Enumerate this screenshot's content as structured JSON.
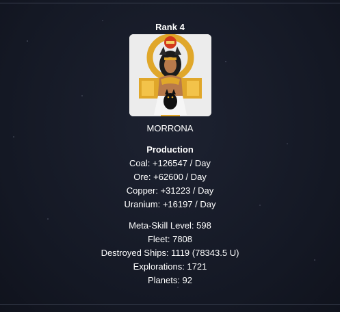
{
  "player": {
    "rank_label": "Rank 4",
    "avatar_icon": "pharaoh-queen-avatar",
    "name": "MORRONA"
  },
  "production": {
    "title": "Production",
    "coal": "Coal: +126547 / Day",
    "ore": "Ore: +62600 / Day",
    "copper": "Copper: +31223 / Day",
    "uranium": "Uranium: +16197 / Day"
  },
  "stats": {
    "meta_skill": "Meta-Skill Level: 598",
    "fleet": "Fleet: 7808",
    "destroyed_ships": "Destroyed Ships: 1119 (78343.5 U)",
    "explorations": "Explorations: 1721",
    "planets": "Planets: 92"
  },
  "colors": {
    "background": "#161a26",
    "text": "#ffffff",
    "frame": "#3a4050"
  }
}
